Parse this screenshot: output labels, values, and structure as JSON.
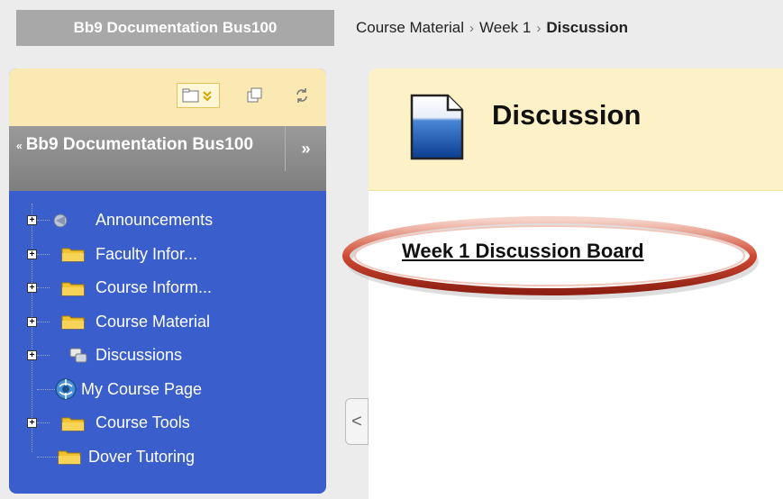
{
  "topbar": {
    "course_tab": "Bb9 Documentation Bus100",
    "breadcrumb": {
      "item1": "Course Material",
      "sep1": "›",
      "item2": "Week 1",
      "sep2": "›",
      "current": "Discussion"
    }
  },
  "sidebar": {
    "toolbar": {
      "icons": [
        "folder-menu-icon",
        "new-window-icon",
        "refresh-icon"
      ]
    },
    "header": {
      "caret": "«",
      "title": "Bb9 Documentation Bus100",
      "collapse": "»"
    },
    "items": [
      {
        "label": "Announcements",
        "icon": "announcements-icon",
        "expandable": true
      },
      {
        "label": "Faculty Infor...",
        "icon": "folder-icon",
        "expandable": true
      },
      {
        "label": "Course Inform...",
        "icon": "folder-icon",
        "expandable": true
      },
      {
        "label": "Course Material",
        "icon": "folder-icon",
        "expandable": true
      },
      {
        "label": "Discussions",
        "icon": "discussions-icon",
        "expandable": true
      },
      {
        "label": "My Course Page",
        "icon": "course-page-icon",
        "expandable": false
      },
      {
        "label": "Course Tools",
        "icon": "folder-icon",
        "expandable": true
      },
      {
        "label": "Dover Tutoring",
        "icon": "folder-icon",
        "expandable": false
      }
    ],
    "expand_glyph": "+",
    "colors": {
      "nav_bg": "#3a5fcd",
      "toolbar_bg": "#fbe9b4",
      "header_bg": "#8c8c8c"
    }
  },
  "side_tab": {
    "glyph": "<"
  },
  "main": {
    "title": "Discussion",
    "link": "Week 1 Discussion Board",
    "colors": {
      "header_bg": "#fdf2c7",
      "highlight_ring": "#c0392b"
    }
  }
}
